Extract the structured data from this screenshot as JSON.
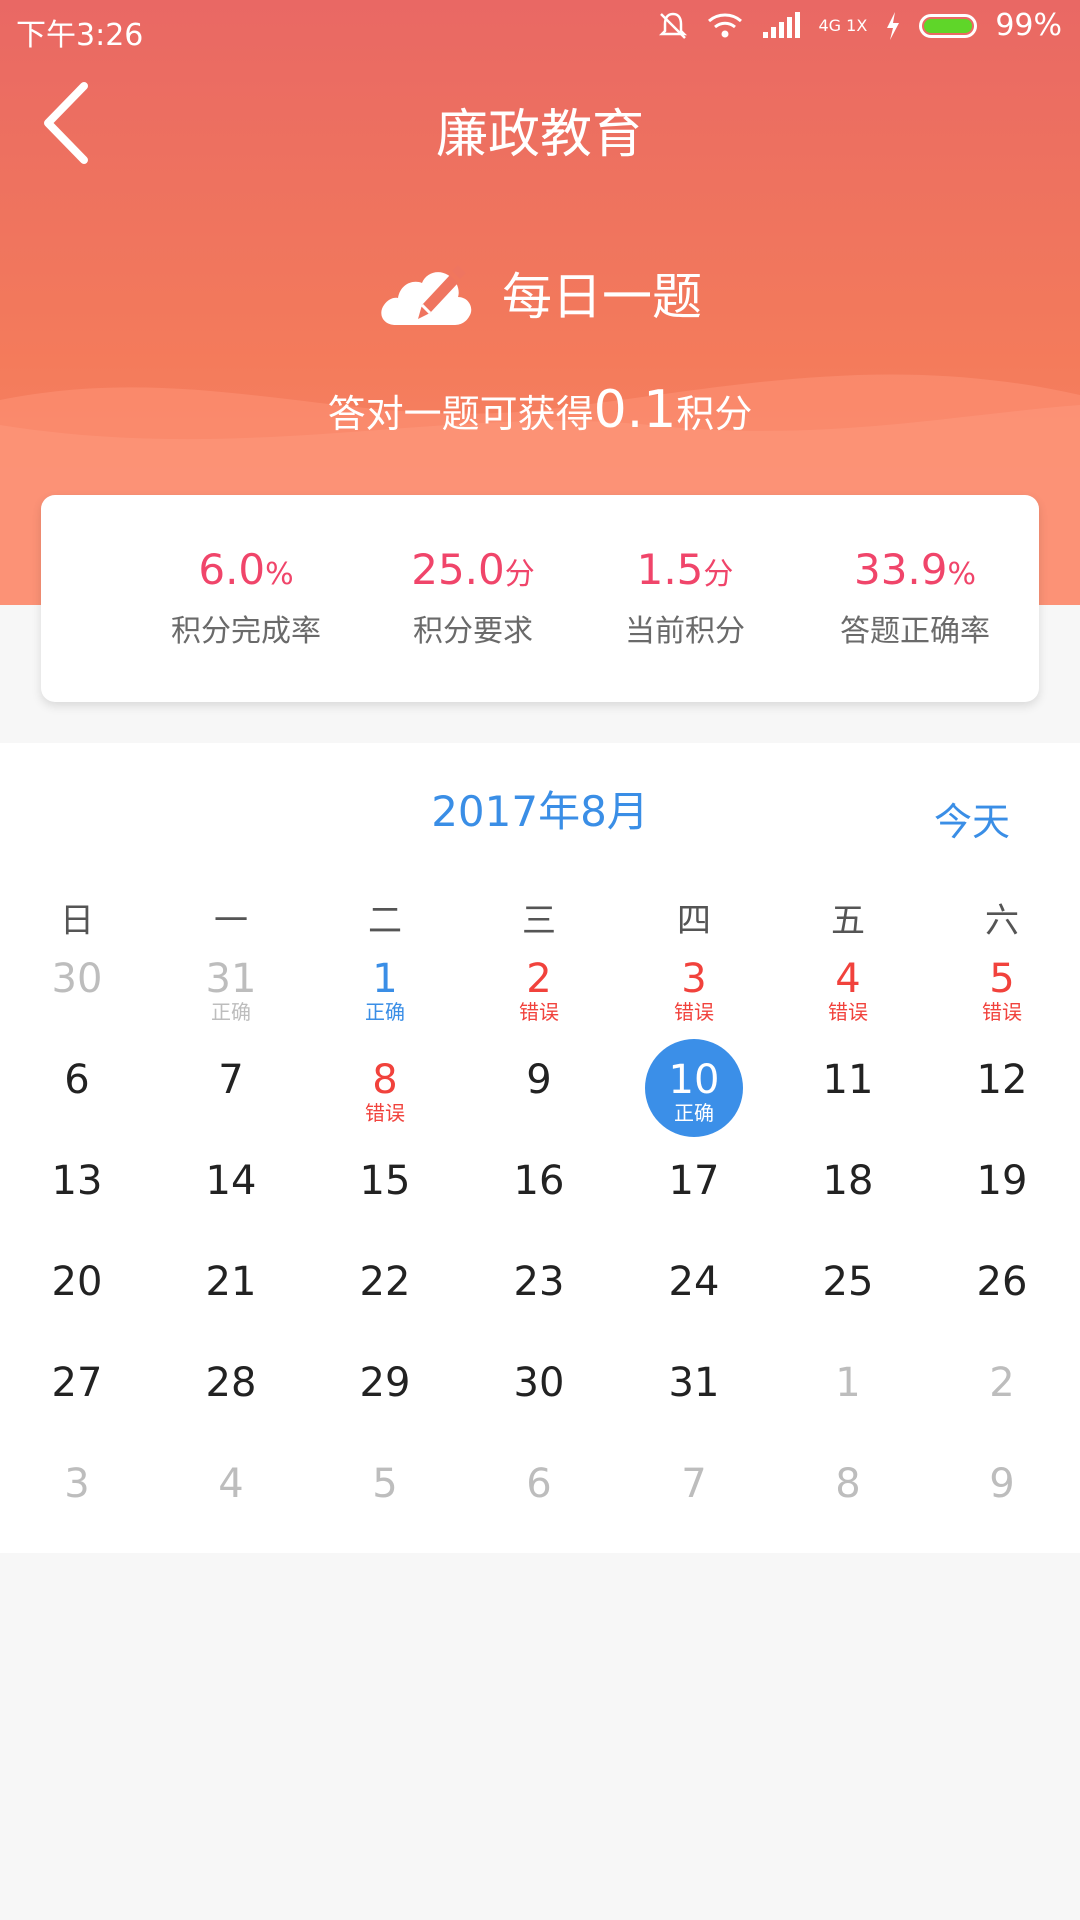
{
  "status_bar": {
    "time": "下午3:26",
    "network": "4G 1X",
    "battery": "99%"
  },
  "header": {
    "title": "廉政教育"
  },
  "banner": {
    "title": "每日一题",
    "sub_prefix": "答对一题可获得",
    "sub_value": "0.1",
    "sub_suffix": "积分"
  },
  "stats": [
    {
      "value": "6.0",
      "unit": "%",
      "label": "积分完成率"
    },
    {
      "value": "25.0",
      "unit": "分",
      "label": "积分要求"
    },
    {
      "value": "1.5",
      "unit": "分",
      "label": "当前积分"
    },
    {
      "value": "33.9",
      "unit": "%",
      "label": "答题正确率"
    }
  ],
  "calendar": {
    "month_title": "2017年8月",
    "today_label": "今天",
    "weekdays": [
      "日",
      "一",
      "二",
      "三",
      "四",
      "五",
      "六"
    ],
    "weeks": [
      [
        {
          "day": "30",
          "other": true
        },
        {
          "day": "31",
          "other": true,
          "tag": "正确"
        },
        {
          "day": "1",
          "status": "correct",
          "tag": "正确"
        },
        {
          "day": "2",
          "status": "wrong",
          "tag": "错误"
        },
        {
          "day": "3",
          "status": "wrong",
          "tag": "错误"
        },
        {
          "day": "4",
          "status": "wrong",
          "tag": "错误"
        },
        {
          "day": "5",
          "status": "wrong",
          "tag": "错误"
        }
      ],
      [
        {
          "day": "6"
        },
        {
          "day": "7"
        },
        {
          "day": "8",
          "status": "wrong",
          "tag": "错误"
        },
        {
          "day": "9"
        },
        {
          "day": "10",
          "selected": true,
          "tag": "正确"
        },
        {
          "day": "11"
        },
        {
          "day": "12"
        }
      ],
      [
        {
          "day": "13"
        },
        {
          "day": "14"
        },
        {
          "day": "15"
        },
        {
          "day": "16"
        },
        {
          "day": "17"
        },
        {
          "day": "18"
        },
        {
          "day": "19"
        }
      ],
      [
        {
          "day": "20"
        },
        {
          "day": "21"
        },
        {
          "day": "22"
        },
        {
          "day": "23"
        },
        {
          "day": "24"
        },
        {
          "day": "25"
        },
        {
          "day": "26"
        }
      ],
      [
        {
          "day": "27"
        },
        {
          "day": "28"
        },
        {
          "day": "29"
        },
        {
          "day": "30"
        },
        {
          "day": "31"
        },
        {
          "day": "1",
          "other": true
        },
        {
          "day": "2",
          "other": true
        }
      ],
      [
        {
          "day": "3",
          "other": true
        },
        {
          "day": "4",
          "other": true
        },
        {
          "day": "5",
          "other": true
        },
        {
          "day": "6",
          "other": true
        },
        {
          "day": "7",
          "other": true
        },
        {
          "day": "8",
          "other": true
        },
        {
          "day": "9",
          "other": true
        }
      ]
    ]
  }
}
